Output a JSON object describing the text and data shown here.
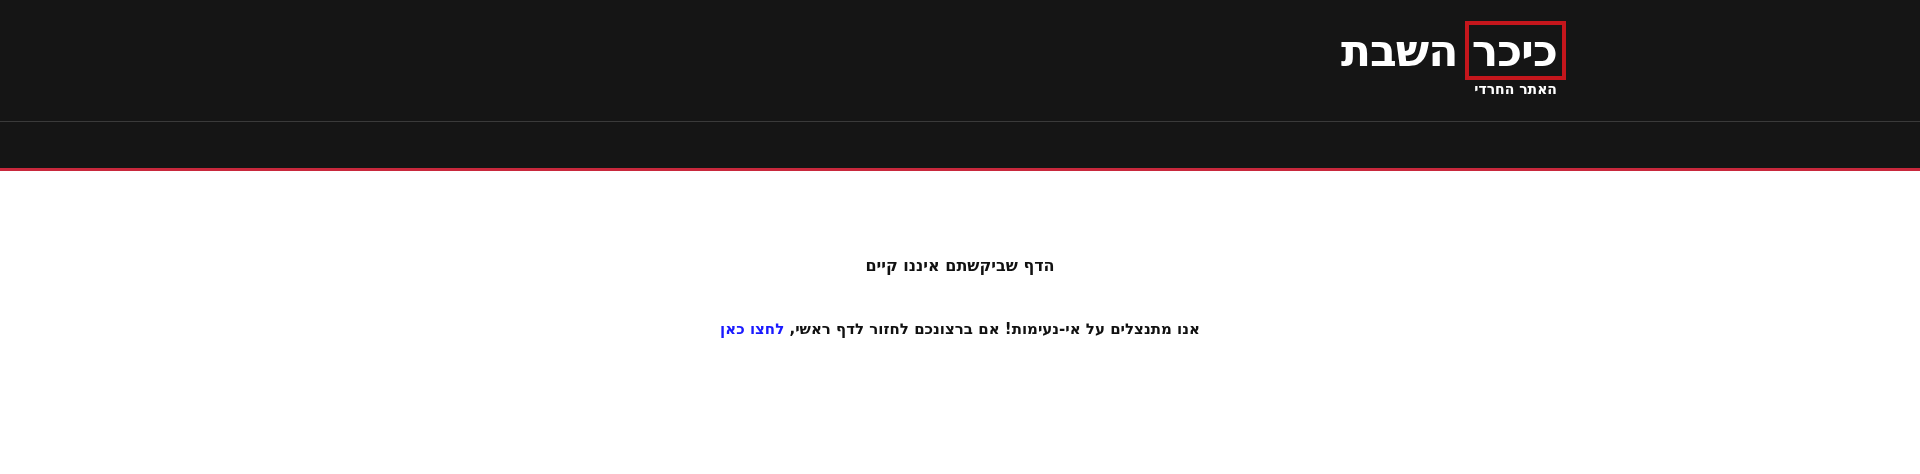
{
  "header": {
    "logo": {
      "title": "כיכר השבת",
      "tagline": "האתר החרדי"
    }
  },
  "error": {
    "title": "הדף שביקשתם איננו קיים",
    "message": "אנו מתנצלים על אי-נעימות! אם ברצונכם לחזור לדף ראשי,",
    "link": "לחצו כאן"
  }
}
